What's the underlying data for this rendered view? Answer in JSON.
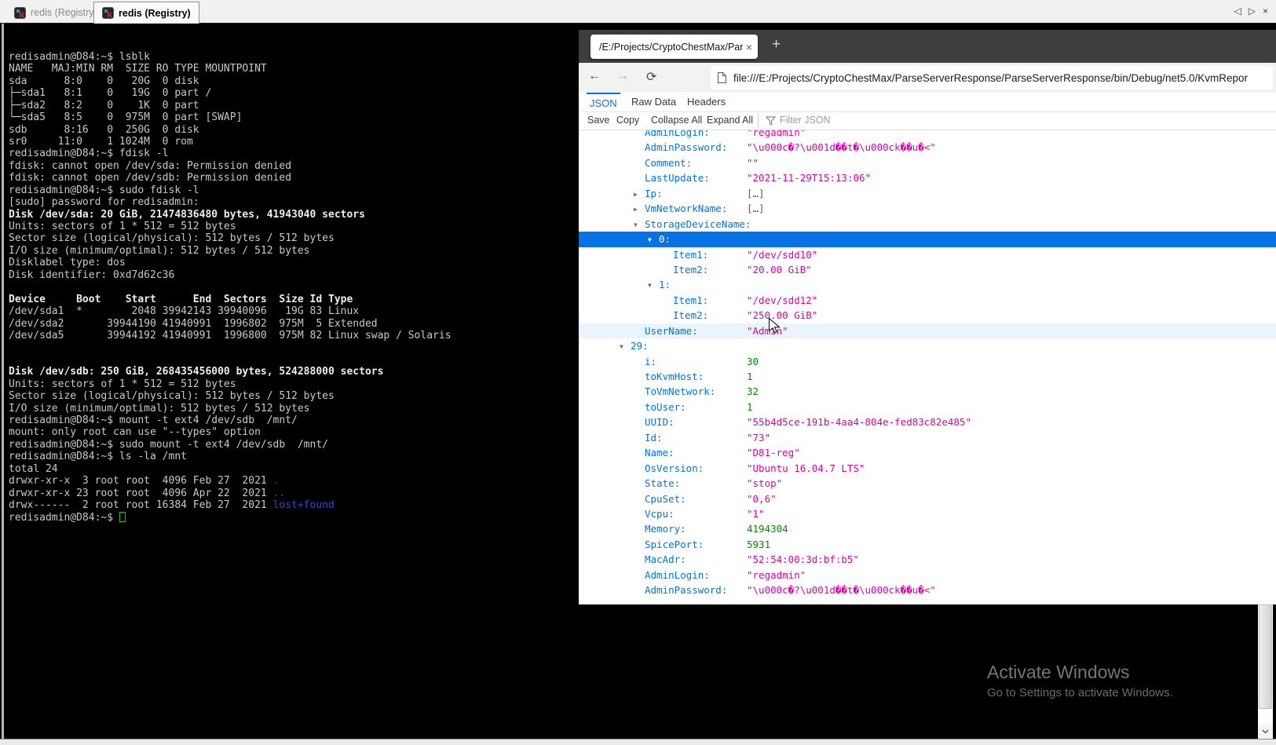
{
  "app": {
    "tabs": [
      {
        "label": "redis (Registry)",
        "active": false
      },
      {
        "label": "redis (Registry)",
        "active": true
      }
    ]
  },
  "icons": {
    "back": "←",
    "forward": "→",
    "reload": "⟳",
    "plus": "+",
    "close_tab": "×",
    "tab_prev": "◁",
    "tab_next": "▷",
    "win_close": "×",
    "twisty_down": "▼",
    "twisty_right": "▶"
  },
  "terminal": {
    "lines": [
      "redisadmin@D84:~$ lsblk",
      "NAME   MAJ:MIN RM  SIZE RO TYPE MOUNTPOINT",
      "sda      8:0    0   20G  0 disk ",
      "├─sda1   8:1    0   19G  0 part /",
      "├─sda2   8:2    0    1K  0 part ",
      "└─sda5   8:5    0  975M  0 part [SWAP]",
      "sdb      8:16   0  250G  0 disk ",
      "sr0     11:0    1 1024M  0 rom  ",
      "redisadmin@D84:~$ fdisk -l",
      "fdisk: cannot open /dev/sda: Permission denied",
      "fdisk: cannot open /dev/sdb: Permission denied",
      "redisadmin@D84:~$ sudo fdisk -l",
      "[sudo] password for redisadmin: ",
      {
        "b": 1,
        "s": "Disk /dev/sda: 20 GiB, 21474836480 bytes, 41943040 sectors"
      },
      "Units: sectors of 1 * 512 = 512 bytes",
      "Sector size (logical/physical): 512 bytes / 512 bytes",
      "I/O size (minimum/optimal): 512 bytes / 512 bytes",
      "Disklabel type: dos",
      "Disk identifier: 0xd7d62c36",
      "",
      {
        "b": 1,
        "s": "Device     Boot    Start      End  Sectors  Size Id Type"
      },
      "/dev/sda1  *        2048 39942143 39940096   19G 83 Linux",
      "/dev/sda2       39944190 41940991  1996802  975M  5 Extended",
      "/dev/sda5       39944192 41940991  1996800  975M 82 Linux swap / Solaris",
      "",
      "",
      {
        "b": 1,
        "s": "Disk /dev/sdb: 250 GiB, 268435456000 bytes, 524288000 sectors"
      },
      "Units: sectors of 1 * 512 = 512 bytes",
      "Sector size (logical/physical): 512 bytes / 512 bytes",
      "I/O size (minimum/optimal): 512 bytes / 512 bytes",
      "redisadmin@D84:~$ mount -t ext4 /dev/sdb  /mnt/",
      "mount: only root can use \"--types\" option",
      "redisadmin@D84:~$ sudo mount -t ext4 /dev/sdb  /mnt/",
      "redisadmin@D84:~$ ls -la /mnt",
      "total 24",
      {
        "s": [
          [
            "drwxr-xr-x  3 root root  4096 Feb 27  2021 ",
            ""
          ],
          [
            ".",
            "d"
          ]
        ]
      },
      {
        "s": [
          [
            "drwxr-xr-x 23 root root  4096 Apr 22  2021 ",
            ""
          ],
          [
            "..",
            "d"
          ]
        ]
      },
      {
        "s": [
          [
            "drwx------  2 root root 16384 Feb 27  2021 ",
            ""
          ],
          [
            "lost+found",
            "d"
          ]
        ]
      },
      {
        "s": "redisadmin@D84:~$ ",
        "cur": 1
      }
    ]
  },
  "browser": {
    "tab_title": "/E:/Projects/CryptoChestMax/Parse",
    "url": "file:///E:/Projects/CryptoChestMax/ParseServerResponse/ParseServerResponse/bin/Debug/net5.0/KvmRepor",
    "viewer_tabs": [
      "JSON",
      "Raw Data",
      "Headers"
    ],
    "toolbar": [
      "Save",
      "Copy",
      "Collapse All",
      "Expand All"
    ],
    "filter_placeholder": "Filter JSON",
    "rows": [
      {
        "lvl": 1,
        "key": "AdminLogin:",
        "val": "regadmin",
        "vt": "str"
      },
      {
        "lvl": 1,
        "key": "AdminPassword:",
        "val": "\\u000c�?\\u001d��t�\\u000ck��u�<",
        "vt": "str"
      },
      {
        "lvl": 1,
        "key": "Comment:",
        "val": "",
        "vt": "str"
      },
      {
        "lvl": 1,
        "key": "LastUpdate:",
        "val": "2021-11-29T15:13:06",
        "vt": "str"
      },
      {
        "lvl": 1,
        "arrow": "right",
        "key": "Ip:",
        "val": "[…]",
        "vt": "col"
      },
      {
        "lvl": 1,
        "arrow": "right",
        "key": "VmNetworkName:",
        "val": "[…]",
        "vt": "col"
      },
      {
        "lvl": 1,
        "arrow": "down",
        "key": "StorageDeviceName:"
      },
      {
        "lvl": 2,
        "arrow": "down",
        "key": "0:",
        "sel": true
      },
      {
        "lvl": 3,
        "key": "Item1:",
        "val": "/dev/sdd10",
        "vt": "str"
      },
      {
        "lvl": 3,
        "key": "Item2:",
        "val": "20.00 GiB",
        "vt": "str"
      },
      {
        "lvl": 2,
        "arrow": "down",
        "key": "1:"
      },
      {
        "lvl": 3,
        "key": "Item1:",
        "val": "/dev/sdd12",
        "vt": "str"
      },
      {
        "lvl": 3,
        "key": "Item2:",
        "val": "250.00 GiB",
        "vt": "str"
      },
      {
        "lvl": 1,
        "key": "UserName:",
        "val": "Admin",
        "vt": "str",
        "hover": true
      },
      {
        "lvl": 0,
        "arrow": "down",
        "key": "29:"
      },
      {
        "lvl": 1,
        "key": "i:",
        "val": "30",
        "vt": "num"
      },
      {
        "lvl": 1,
        "key": "toKvmHost:",
        "val": "1",
        "vt": "num"
      },
      {
        "lvl": 1,
        "key": "ToVmNetwork:",
        "val": "32",
        "vt": "num"
      },
      {
        "lvl": 1,
        "key": "toUser:",
        "val": "1",
        "vt": "num"
      },
      {
        "lvl": 1,
        "key": "UUID:",
        "val": "55b4d5ce-191b-4aa4-804e-fed83c82e485",
        "vt": "str"
      },
      {
        "lvl": 1,
        "key": "Id:",
        "val": "73",
        "vt": "str"
      },
      {
        "lvl": 1,
        "key": "Name:",
        "val": "D81-reg",
        "vt": "str"
      },
      {
        "lvl": 1,
        "key": "OsVersion:",
        "val": "Ubuntu 16.04.7 LTS",
        "vt": "str"
      },
      {
        "lvl": 1,
        "key": "State:",
        "val": "stop",
        "vt": "str"
      },
      {
        "lvl": 1,
        "key": "CpuSet:",
        "val": "0,6",
        "vt": "str"
      },
      {
        "lvl": 1,
        "key": "Vcpu:",
        "val": "1",
        "vt": "str"
      },
      {
        "lvl": 1,
        "key": "Memory:",
        "val": "4194304",
        "vt": "num"
      },
      {
        "lvl": 1,
        "key": "SpicePort:",
        "val": "5931",
        "vt": "num"
      },
      {
        "lvl": 1,
        "key": "MacAdr:",
        "val": "52:54:00:3d:bf:b5",
        "vt": "str"
      },
      {
        "lvl": 1,
        "key": "AdminLogin:",
        "val": "regadmin",
        "vt": "str"
      },
      {
        "lvl": 1,
        "key": "AdminPassword:",
        "val": "\\u000c�?\\u001d��t�\\u000ck��u�<",
        "vt": "str"
      }
    ]
  },
  "watermark": {
    "title": "Activate Windows",
    "subtitle": "Go to Settings to activate Windows."
  }
}
